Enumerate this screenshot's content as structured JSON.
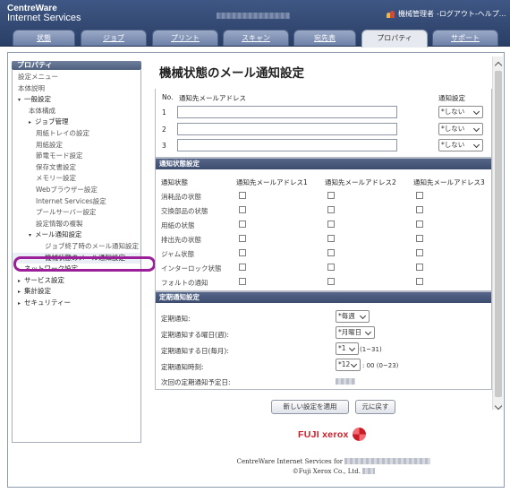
{
  "header": {
    "brand_line1": "CentreWare",
    "brand_line2": "Internet Services",
    "user": "機械管理者",
    "links": "-ログアウト-ヘルプ..."
  },
  "tabs": [
    {
      "label": "状態"
    },
    {
      "label": "ジョブ"
    },
    {
      "label": "プリント"
    },
    {
      "label": "スキャン"
    },
    {
      "label": "宛先表"
    },
    {
      "label": "プロパティ",
      "active": true
    },
    {
      "label": "サポート"
    }
  ],
  "sidebar": {
    "title": "プロパティ",
    "items": [
      {
        "label": "設定メニュー"
      },
      {
        "label": "本体説明"
      },
      {
        "label": "一般設定",
        "arrow": "▾"
      },
      {
        "label": "本体構成"
      },
      {
        "label": "ジョブ管理",
        "arrow": "▸"
      },
      {
        "label": "用紙トレイの設定"
      },
      {
        "label": "用紙設定"
      },
      {
        "label": "節電モード設定"
      },
      {
        "label": "保存文書設定"
      },
      {
        "label": "メモリー設定"
      },
      {
        "label": "Webブラウザー設定"
      },
      {
        "label": "Internet Services設定"
      },
      {
        "label": "プールサーバー設定"
      },
      {
        "label": "設定情報の複製"
      },
      {
        "label": "メール通知設定",
        "arrow": "▾"
      },
      {
        "label": "ジョブ終了時のメール通知設定"
      },
      {
        "label": "機械状態のメール通知設定"
      },
      {
        "label": "ネットワーク設定",
        "arrow": "▸"
      },
      {
        "label": "サービス設定",
        "arrow": "▸"
      },
      {
        "label": "集計設定",
        "arrow": "▸"
      },
      {
        "label": "セキュリティー",
        "arrow": "▸"
      }
    ]
  },
  "main": {
    "title": "機械状態のメール通知設定",
    "email_panel": {
      "col_no": "No.",
      "col_address": "通知先メールアドレス",
      "col_setting": "通知設定",
      "rows": [
        {
          "no": "1",
          "value": "",
          "setting": "*しない"
        },
        {
          "no": "2",
          "value": "",
          "setting": "*しない"
        },
        {
          "no": "3",
          "value": "",
          "setting": "*しない"
        }
      ]
    },
    "status_panel": {
      "heading": "通知状態設定",
      "col_label": "通知状態",
      "col1": "通知先メールアドレス1",
      "col2": "通知先メールアドレス2",
      "col3": "通知先メールアドレス3",
      "rows": [
        {
          "label": "消耗品の状態"
        },
        {
          "label": "交換部品の状態"
        },
        {
          "label": "用紙の状態"
        },
        {
          "label": "排出先の状態"
        },
        {
          "label": "ジャム状態"
        },
        {
          "label": "インターロック状態"
        },
        {
          "label": "フォルトの通知"
        }
      ]
    },
    "periodic_panel": {
      "heading": "定期通知設定",
      "notify_label": "定期通知:",
      "notify_value": "*毎週",
      "weekday_label": "定期通知する曜日(週):",
      "weekday_value": "*月曜日",
      "day_label": "定期通知する日(毎月):",
      "day_value": "*1",
      "day_range": "(1~31)",
      "time_label": "定期通知時刻:",
      "time_value": "*12",
      "time_suffix": ": 00 (0~23)",
      "next_label": "次回の定期通知予定日:"
    },
    "apply_button": "新しい設定を適用",
    "reset_button": "元に戻す",
    "logo_text": "FUJI xerox",
    "footer_line1": "CentreWare Internet Services for",
    "footer_line2": "©Fuji Xerox Co., Ltd."
  },
  "colors": {
    "header_bg": "#34486f",
    "panel_header": "#4a5a7c",
    "highlight_ring": "#9a1f98",
    "logo_red": "#cc1a25"
  },
  "icons": [
    "user-icon",
    "xerox-logo-icon",
    "chevron-down-icon",
    "scroll-up-icon",
    "scroll-down-icon"
  ]
}
